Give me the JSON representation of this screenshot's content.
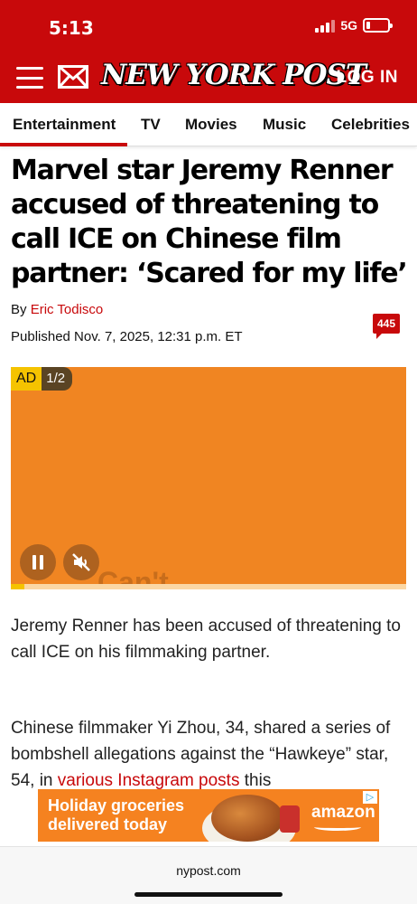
{
  "status": {
    "time": "5:13",
    "network": "5G",
    "battery_level": 0.2
  },
  "header": {
    "logo": "NEW YORK POST",
    "login_label": "LOG IN",
    "menu_icon": "hamburger-menu-icon",
    "mail_icon": "envelope-icon",
    "brand_color": "#c8090b"
  },
  "nav": {
    "items": [
      "Entertainment",
      "TV",
      "Movies",
      "Music",
      "Celebrities"
    ],
    "active": "Entertainment"
  },
  "article": {
    "headline_lines": [
      "Marvel star Jeremy Renner",
      "accused of threatening to",
      "call ICE on Chinese film",
      "partner: ‘Scared for my life’"
    ],
    "by_prefix": "By",
    "author": "Eric Todisco",
    "published": "Published Nov. 7, 2025, 12:31 p.m. ET",
    "comment_count": "445",
    "paragraph1": "Jeremy Renner has been accused of threatening to call ICE on his filmmaking partner.",
    "paragraph2_text": "Chinese filmmaker Yi Zhou, 34, shared a series of bombshell allegations against the “Hawkeye” star, 54, in",
    "paragraph2_link": "various Instagram posts",
    "paragraph2_tail": "this"
  },
  "video_ad": {
    "ad_tag": "AD",
    "ad_count": "1/2",
    "watermark": "Can't",
    "progress": 0.035,
    "background_color": "#f08522"
  },
  "banner_ad": {
    "line1": "Holiday groceries",
    "line2": "delivered today",
    "brand": "amazon",
    "adchoices_icon": "adchoices-icon"
  },
  "browser": {
    "url": "nypost.com"
  }
}
